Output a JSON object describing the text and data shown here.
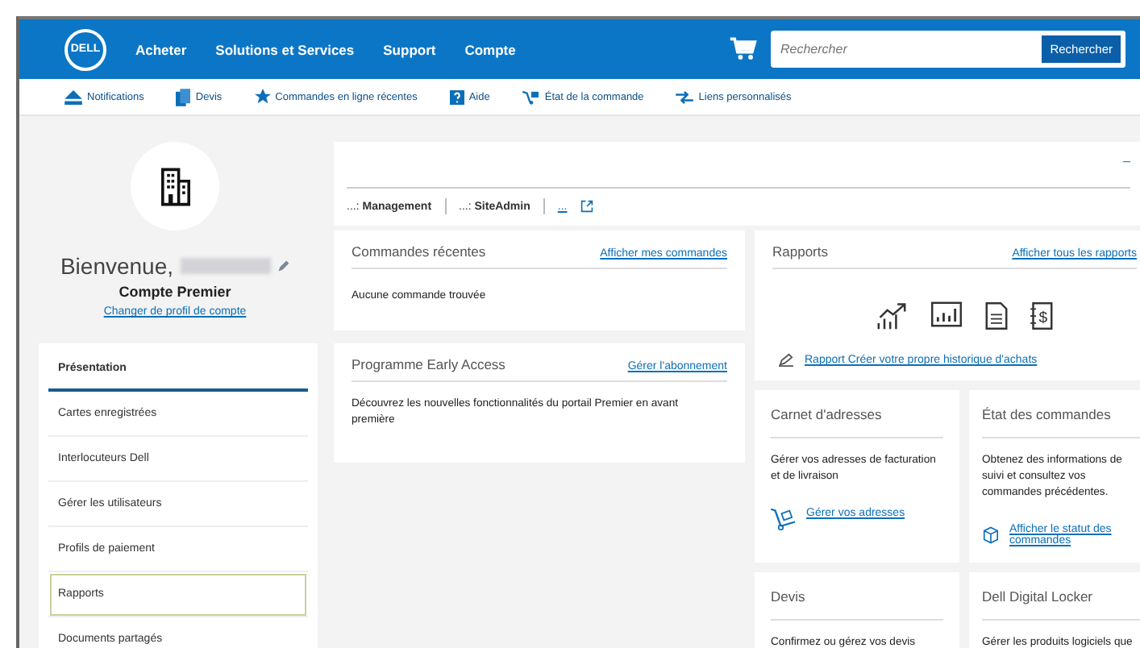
{
  "header": {
    "logo": "DELL",
    "nav": [
      "Acheter",
      "Solutions et Services",
      "Support",
      "Compte"
    ],
    "search": {
      "placeholder": "Rechercher"
    },
    "search_button": "Rechercher"
  },
  "subnav": [
    {
      "kind": "notifications",
      "label": "Notifications"
    },
    {
      "kind": "quotes",
      "label": "Devis"
    },
    {
      "kind": "star",
      "label": "Commandes en ligne récentes"
    },
    {
      "kind": "help",
      "label": "Aide"
    },
    {
      "kind": "status",
      "label": "État de la commande"
    },
    {
      "kind": "links",
      "label": "Liens personnalisés"
    }
  ],
  "profile": {
    "welcome": "Bienvenue,",
    "account": "Compte Premier",
    "change_link": "Changer de profil de compte"
  },
  "sidebar": {
    "items": [
      {
        "label": "Présentation",
        "selected": true,
        "focused": false
      },
      {
        "label": "Cartes enregistrées",
        "selected": false,
        "focused": false
      },
      {
        "label": "Interlocuteurs Dell",
        "selected": false,
        "focused": false
      },
      {
        "label": "Gérer les utilisateurs",
        "selected": false,
        "focused": false
      },
      {
        "label": "Profils de paiement",
        "selected": false,
        "focused": false
      },
      {
        "label": "Rapports",
        "selected": false,
        "focused": true
      },
      {
        "label": "Documents partagés",
        "selected": false,
        "focused": false
      }
    ]
  },
  "admin_bar": {
    "corner": "_",
    "items": [
      {
        "prefix": "...:",
        "label": "Management"
      },
      {
        "prefix": "...:",
        "label": "SiteAdmin"
      }
    ],
    "external_link": "..."
  },
  "recent_orders": {
    "title": "Commandes récentes",
    "link": "Afficher mes commandes",
    "body": "Aucune commande trouvée"
  },
  "early_access": {
    "title": "Programme Early Access",
    "link": "Gérer l'abonnement",
    "body": "Découvrez les nouvelles fonctionnalités du portail Premier en avant première"
  },
  "reports": {
    "title": "Rapports",
    "link": "Afficher tous les rapports",
    "report_link": "Rapport Créer votre propre historique d'achats",
    "invoice_symbol": "$"
  },
  "address_book": {
    "title": "Carnet d'adresses",
    "body": "Gérer vos adresses de facturation et de livraison",
    "link": "Gérer vos adresses"
  },
  "order_status": {
    "title": "État des commandes",
    "body": "Obtenez des informations de suivi et consultez vos commandes précédentes.",
    "link": "Afficher le statut des commandes"
  },
  "quotes": {
    "title": "Devis",
    "body": "Confirmez ou gérez vos devis"
  },
  "digital_locker": {
    "title": "Dell Digital Locker",
    "body": "Gérer les produits logiciels que"
  }
}
